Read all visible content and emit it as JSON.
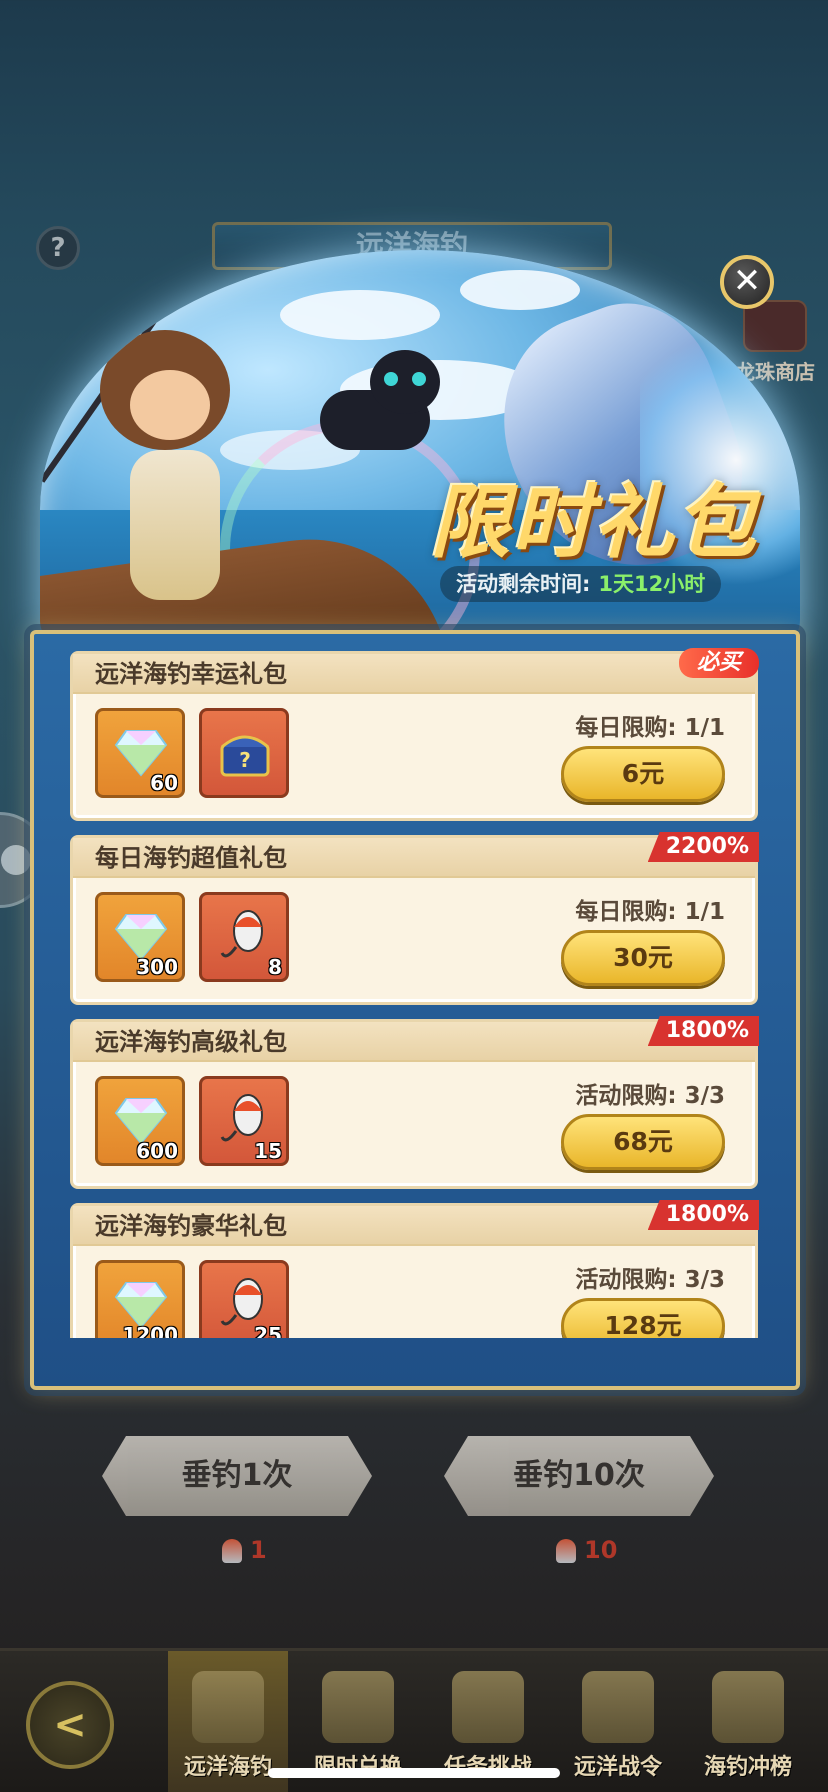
{
  "background": {
    "title": "远洋海钓",
    "help_label": "?",
    "side_shop_label": "龙珠商店"
  },
  "popup": {
    "promo_title": "限时礼包",
    "timer_label": "活动剩余时间:",
    "timer_value": "1天12小时",
    "close_label": "✕",
    "packs": [
      {
        "name": "远洋海钓幸运礼包",
        "badge": "必买",
        "items": [
          {
            "icon": "diamond-icon",
            "count": "60"
          },
          {
            "icon": "treasure-chest-icon",
            "count": ""
          }
        ],
        "limit": "每日限购:  1/1",
        "price": "6元"
      },
      {
        "name": "每日海钓超值礼包",
        "badge": "2200%",
        "items": [
          {
            "icon": "diamond-icon",
            "count": "300"
          },
          {
            "icon": "fishing-lure-icon",
            "count": "8"
          }
        ],
        "limit": "每日限购:  1/1",
        "price": "30元"
      },
      {
        "name": "远洋海钓高级礼包",
        "badge": "1800%",
        "items": [
          {
            "icon": "diamond-icon",
            "count": "600"
          },
          {
            "icon": "fishing-lure-icon",
            "count": "15"
          }
        ],
        "limit": "活动限购:  3/3",
        "price": "68元"
      },
      {
        "name": "远洋海钓豪华礼包",
        "badge": "1800%",
        "items": [
          {
            "icon": "diamond-icon",
            "count": "1200"
          },
          {
            "icon": "fishing-lure-icon",
            "count": "25"
          }
        ],
        "limit": "活动限购:  3/3",
        "price": "128元"
      }
    ]
  },
  "actions": {
    "cast_once": "垂钓1次",
    "cast_ten": "垂钓10次",
    "cost_once": "1",
    "cost_ten": "10"
  },
  "nav": {
    "back_label": "<",
    "items": [
      {
        "label": "远洋海钓",
        "icon": "fish-icon",
        "active": true
      },
      {
        "label": "限时兑换",
        "icon": "gift-box-icon",
        "active": false
      },
      {
        "label": "任务挑战",
        "icon": "scroll-icon",
        "active": false
      },
      {
        "label": "远洋战令",
        "icon": "crossed-swords-icon",
        "active": false
      },
      {
        "label": "海钓冲榜",
        "icon": "podium-icon",
        "active": false
      }
    ]
  },
  "colors": {
    "badge_red": "#d8332f",
    "buy_gold": "#e9b62a",
    "promo_gold": "#ffd86a",
    "timer_green": "#8bf06a"
  }
}
